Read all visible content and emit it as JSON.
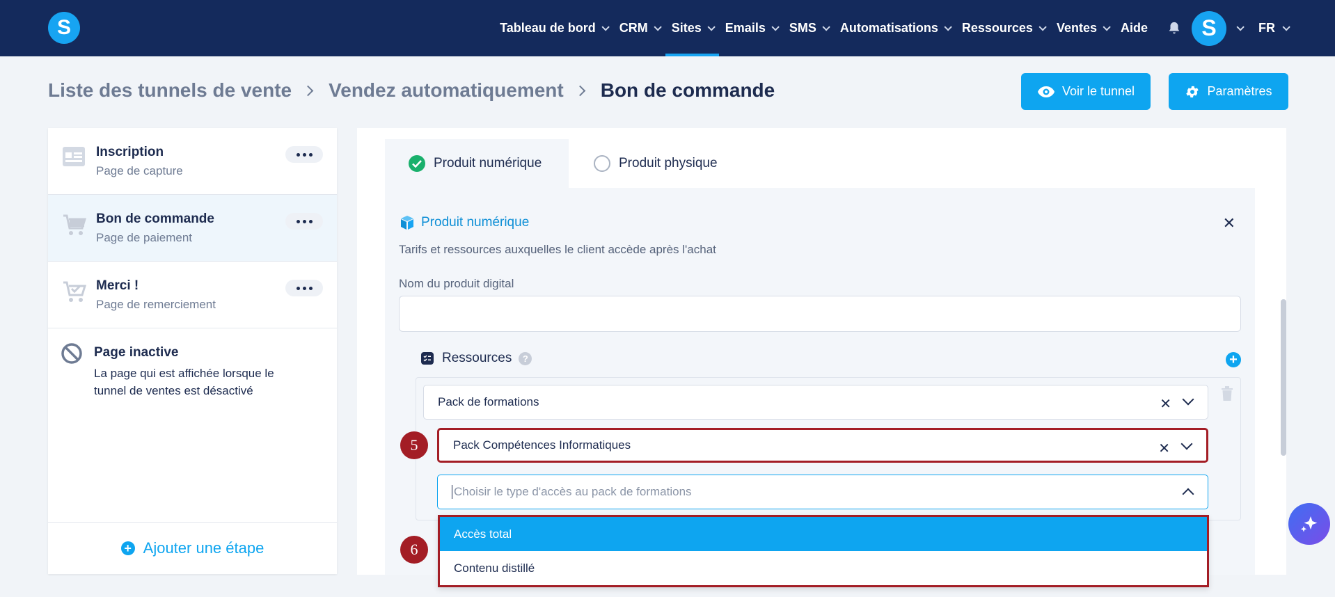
{
  "nav": {
    "items": [
      {
        "label": "Tableau de bord",
        "active": false
      },
      {
        "label": "CRM",
        "active": false
      },
      {
        "label": "Sites",
        "active": true
      },
      {
        "label": "Emails",
        "active": false
      },
      {
        "label": "SMS",
        "active": false
      },
      {
        "label": "Automatisations",
        "active": false
      },
      {
        "label": "Ressources",
        "active": false
      },
      {
        "label": "Ventes",
        "active": false
      }
    ],
    "help": "Aide",
    "lang": "FR",
    "logo_letter": "S",
    "avatar_letter": "S"
  },
  "breadcrumb": {
    "items": [
      "Liste des tunnels de vente",
      "Vendez automatiquement",
      "Bon de commande"
    ]
  },
  "actions": {
    "view": "Voir le tunnel",
    "settings": "Paramètres"
  },
  "steps": [
    {
      "title": "Inscription",
      "subtitle": "Page de capture",
      "icon": "form-icon"
    },
    {
      "title": "Bon de commande",
      "subtitle": "Page de paiement",
      "icon": "cart-icon"
    },
    {
      "title": "Merci !",
      "subtitle": "Page de remerciement",
      "icon": "cart-check-icon"
    }
  ],
  "inactive_page": {
    "title": "Page inactive",
    "description": "La page qui est affichée lorsque le tunnel de ventes est désactivé"
  },
  "add_step": "Ajouter une étape",
  "product_tabs": {
    "digital": "Produit numérique",
    "physical": "Produit physique"
  },
  "product_card": {
    "title": "Produit numérique",
    "description": "Tarifs et ressources auxquelles le client accède après l'achat",
    "name_label": "Nom du produit digital",
    "name_value": ""
  },
  "resources": {
    "label": "Ressources",
    "help": "?",
    "type_value": "Pack de formations",
    "pack_value": "Pack Compétences Informatiques",
    "access_placeholder": "Choisir le type d'accès au pack de formations",
    "options": [
      "Accès total",
      "Contenu distillé"
    ]
  },
  "annotations": {
    "step5": "5",
    "step6": "6"
  },
  "colors": {
    "navbar": "#142a5c",
    "accent": "#0ea5f0",
    "highlight_border": "#a31d25",
    "success": "#19b06c"
  }
}
